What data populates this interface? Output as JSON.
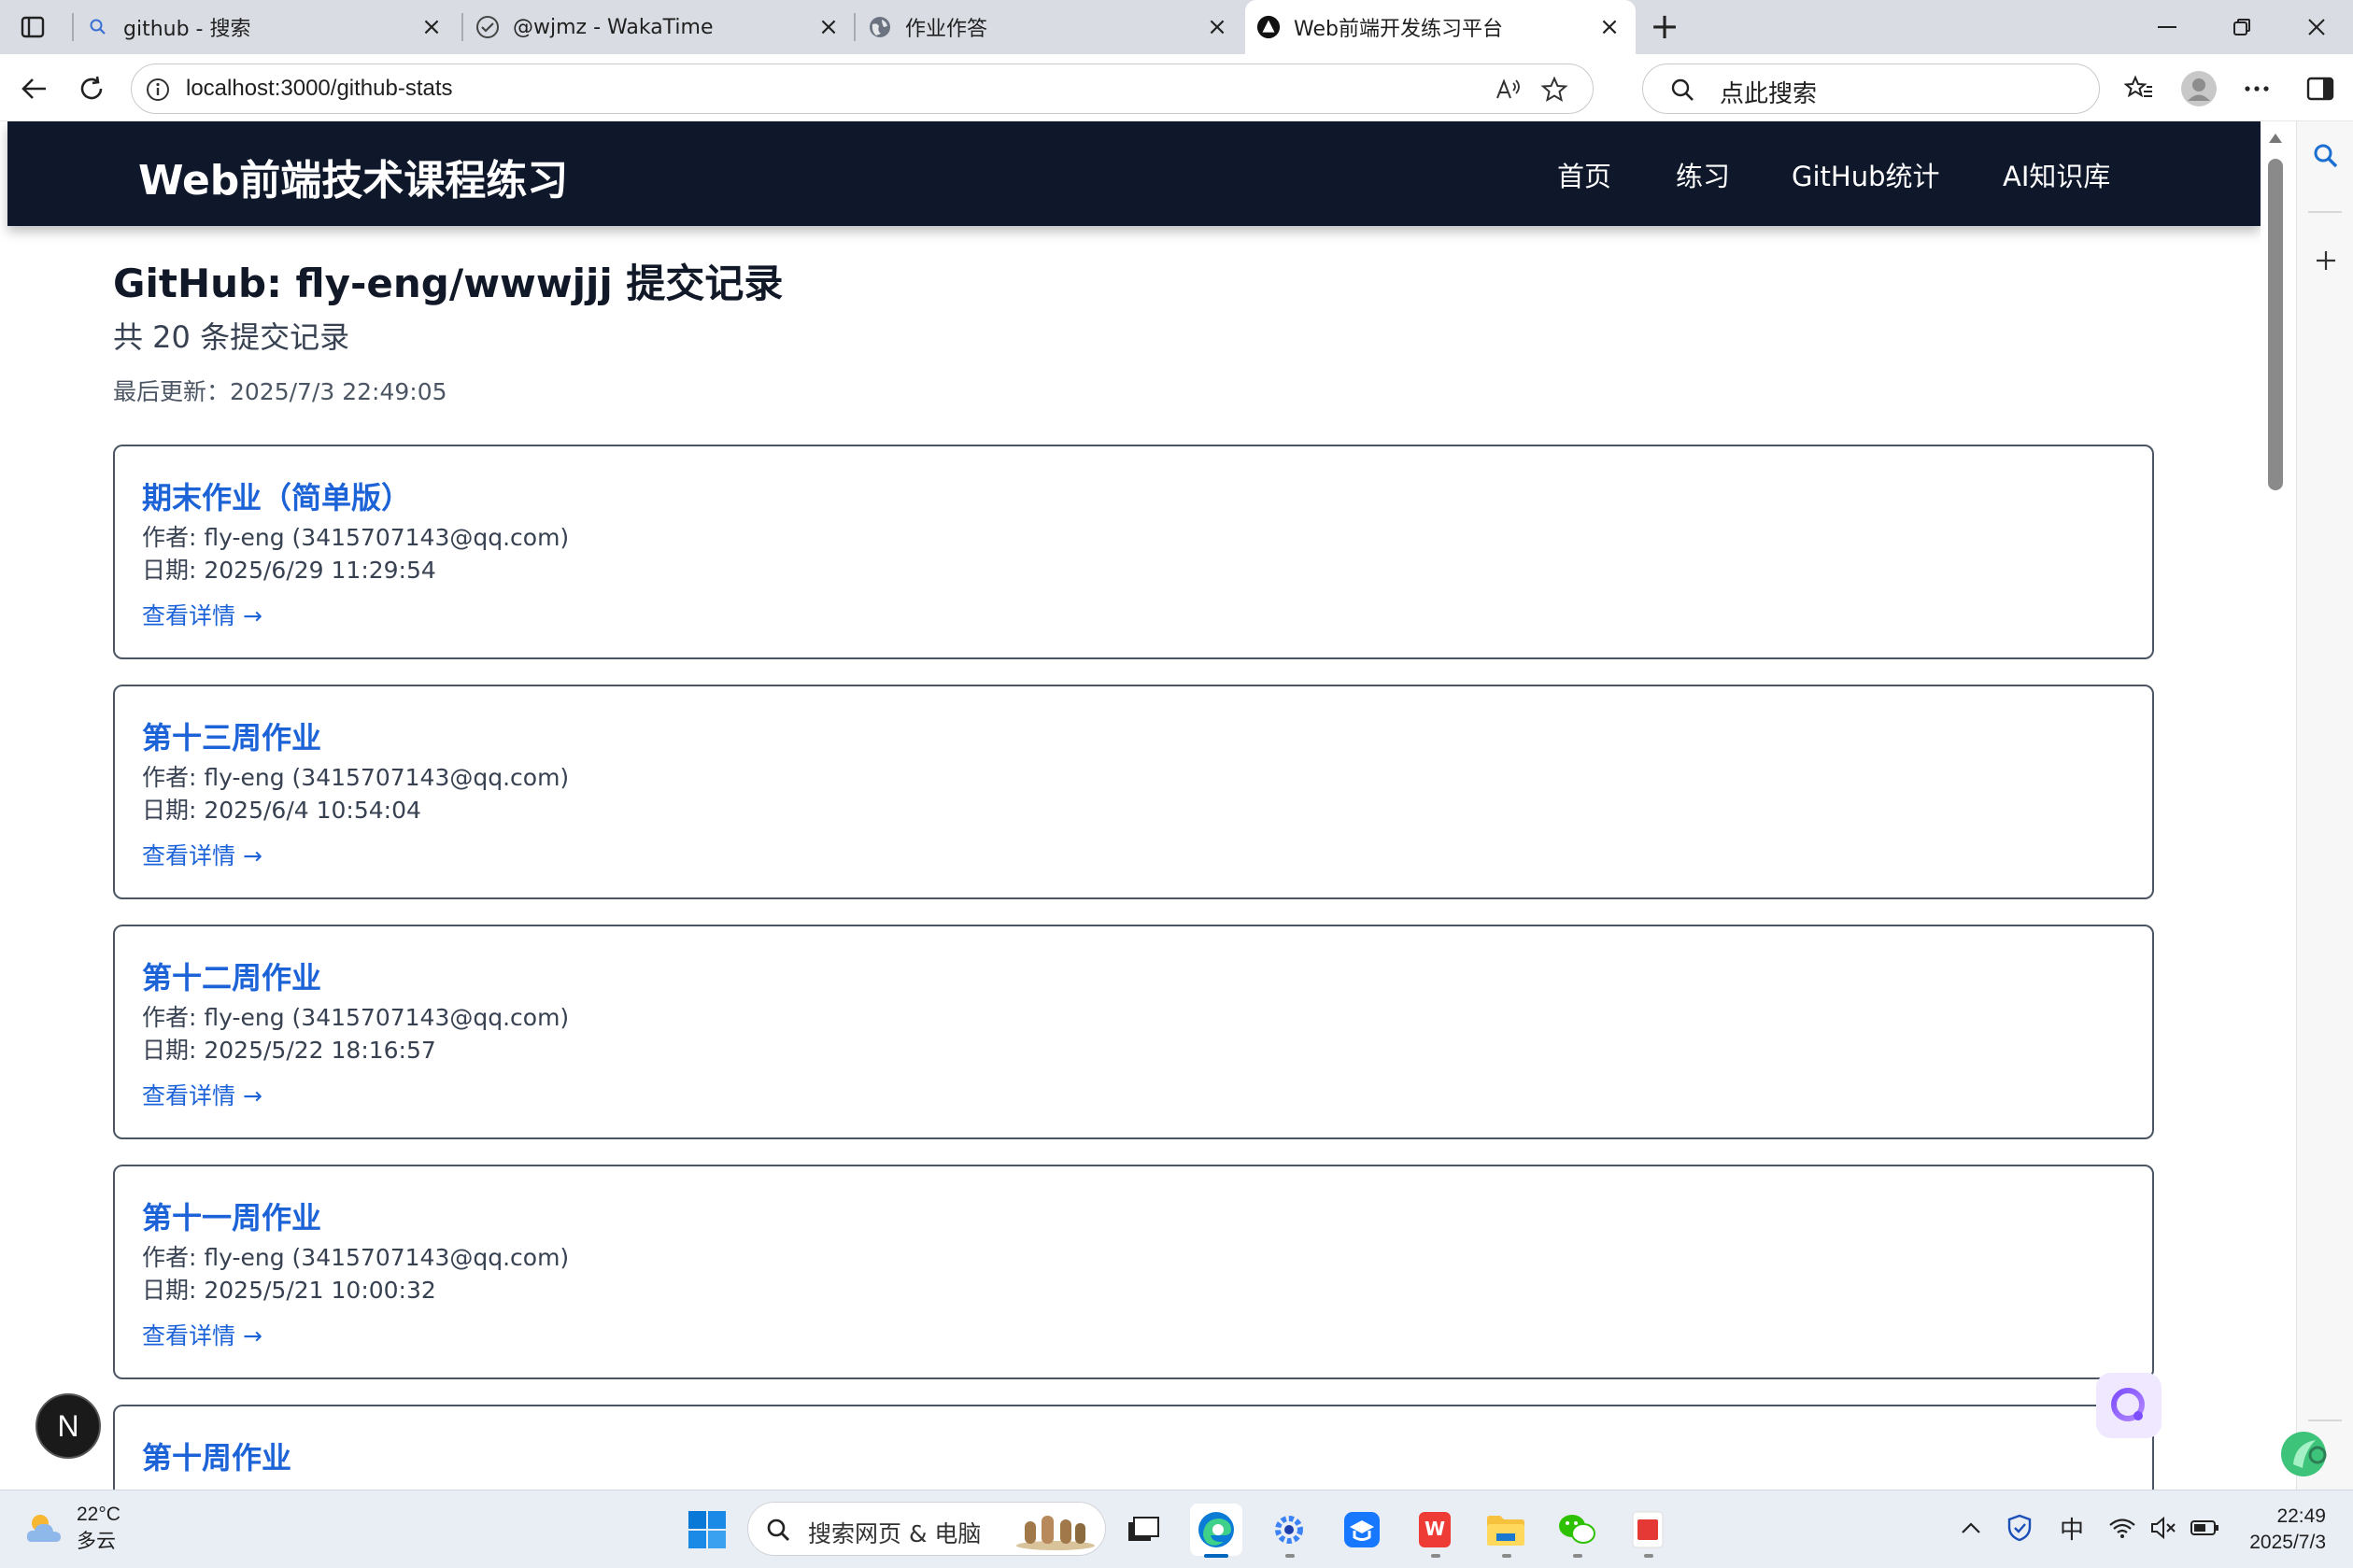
{
  "browser": {
    "tabs": [
      {
        "title": "github - 搜索",
        "icon": "search-icon"
      },
      {
        "title": "@wjmz - WakaTime",
        "icon": "wakatime-icon"
      },
      {
        "title": "作业作答",
        "icon": "globe-icon"
      },
      {
        "title": "Web前端开发练习平台",
        "icon": "nextjs-icon",
        "active": true
      }
    ],
    "url": "localhost:3000/github-stats",
    "search_placeholder": "点此搜索"
  },
  "site": {
    "brand": "Web前端技术课程练习",
    "nav": [
      "首页",
      "练习",
      "GitHub统计",
      "AI知识库"
    ]
  },
  "page": {
    "title": "GitHub: fly-eng/wwwjjj 提交记录",
    "subtitle": "共 20 条提交记录",
    "last_updated": "最后更新：2025/7/3 22:49:05"
  },
  "commits": [
    {
      "title": "期末作业（简单版）",
      "author": "作者: fly-eng (3415707143@qq.com)",
      "date": "日期: 2025/6/29 11:29:54",
      "link": "查看详情 →"
    },
    {
      "title": "第十三周作业",
      "author": "作者: fly-eng (3415707143@qq.com)",
      "date": "日期: 2025/6/4 10:54:04",
      "link": "查看详情 →"
    },
    {
      "title": "第十二周作业",
      "author": "作者: fly-eng (3415707143@qq.com)",
      "date": "日期: 2025/5/22 18:16:57",
      "link": "查看详情 →"
    },
    {
      "title": "第十一周作业",
      "author": "作者: fly-eng (3415707143@qq.com)",
      "date": "日期: 2025/5/21 10:00:32",
      "link": "查看详情 →"
    },
    {
      "title": "第十周作业",
      "author": "",
      "date": "",
      "link": ""
    }
  ],
  "badges": {
    "next": "N"
  },
  "taskbar": {
    "weather_temp": "22°C",
    "weather_cond": "多云",
    "search_text": "搜索网页 & 电脑",
    "ime": "中",
    "time": "22:49",
    "date": "2025/7/3"
  },
  "colors": {
    "header_bg": "#0f172a",
    "link": "#1d63d8",
    "card_border": "#4b5563"
  }
}
